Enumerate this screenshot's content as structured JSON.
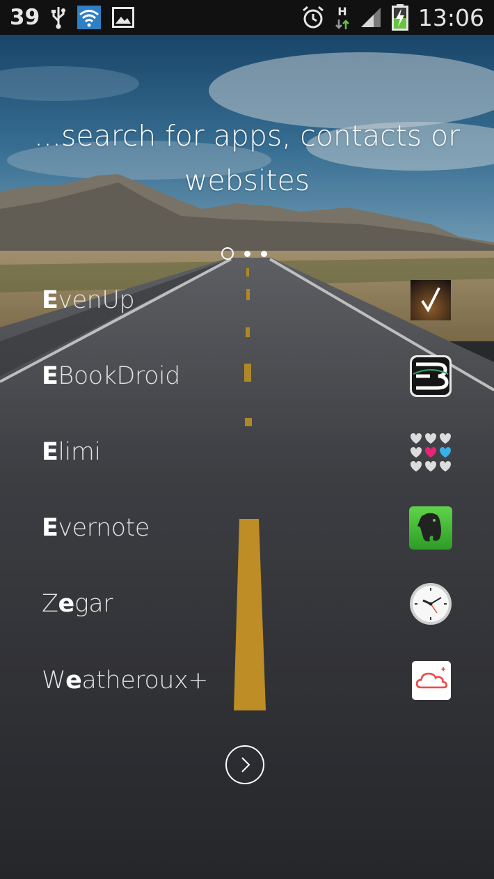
{
  "status_bar": {
    "notification_count": "39",
    "network_type": "H",
    "time": "13:06",
    "icons": [
      "usb-icon",
      "wifi-icon",
      "image-icon",
      "alarm-icon",
      "data-arrows-icon",
      "signal-icon",
      "battery-charging-icon"
    ]
  },
  "headline": "...search for apps, contacts or websites",
  "pager": {
    "pages": 3,
    "active_index": 0
  },
  "apps": [
    {
      "prefix": "E",
      "rest": "venUp",
      "icon": "evenup-check-icon"
    },
    {
      "prefix": "E",
      "rest": "BookDroid",
      "icon": "ebookdroid-icon"
    },
    {
      "prefix": "E",
      "rest": "limi",
      "icon": "elimi-hearts-icon"
    },
    {
      "prefix": "E",
      "rest": "vernote",
      "icon": "evernote-elephant-icon"
    },
    {
      "pre": "Z",
      "mid": "e",
      "post": "gar",
      "icon": "clock-icon"
    },
    {
      "pre": "W",
      "mid": "e",
      "post": "atheroux+",
      "icon": "weather-cloud-icon"
    }
  ],
  "more_button_icon": "chevron-right-icon"
}
